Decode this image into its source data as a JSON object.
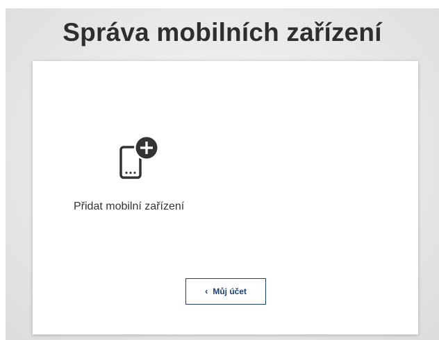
{
  "page": {
    "title": "Správa mobilních zařízení"
  },
  "actions": {
    "add_device_label": "Přidat mobilní zařízení",
    "account_button_label": "Můj účet",
    "account_button_icon": "chevron-left-icon",
    "add_device_icon": "mobile-plus-icon"
  },
  "colors": {
    "title": "#2e2e2e",
    "button_border": "#1d3f73",
    "icon": "#333333"
  }
}
